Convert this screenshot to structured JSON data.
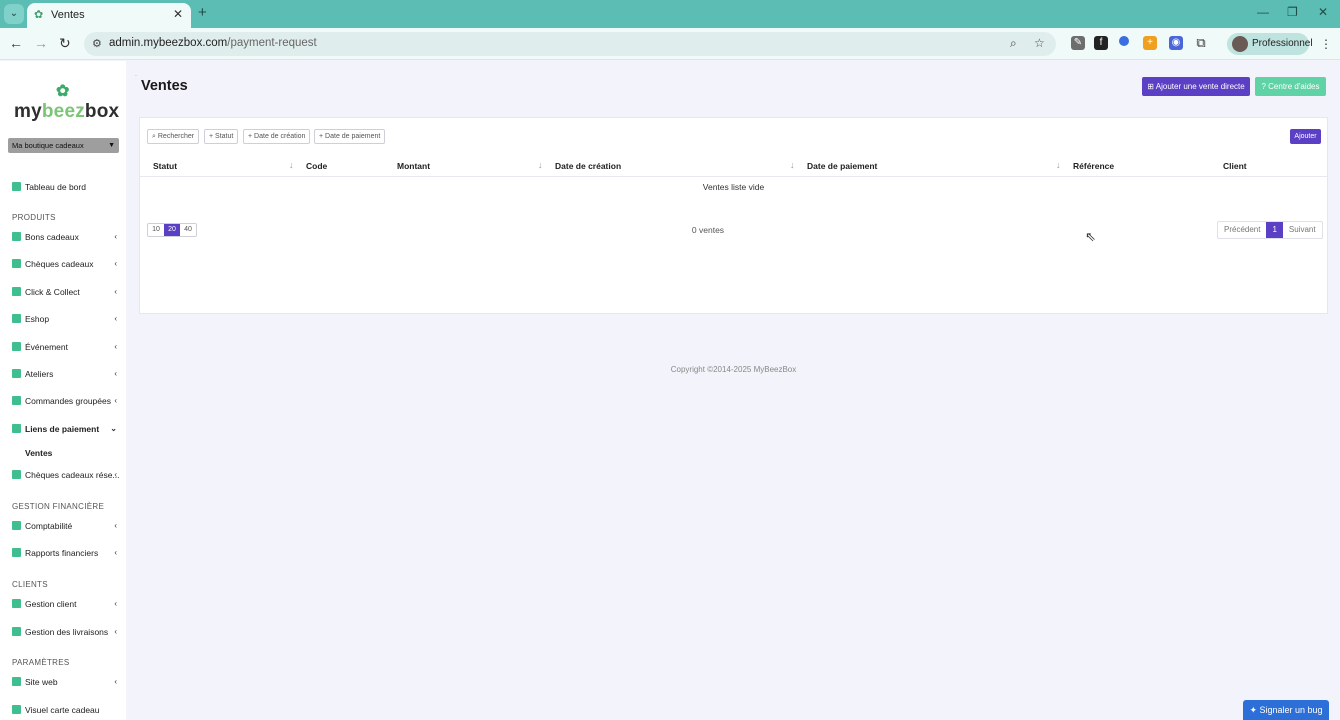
{
  "browser": {
    "tab_title": "Ventes",
    "url_host": "admin.mybeezbox.com",
    "url_path": "/payment-request",
    "profile_label": "Professionnel"
  },
  "sidebar": {
    "logo": {
      "part1": "my",
      "part2": "beez",
      "part3": "box"
    },
    "shop_select": "Ma boutique cadeaux",
    "dashboard": "Tableau de bord",
    "sections": {
      "produits": "PRODUITS",
      "gestion_financiere": "GESTION FINANCIÈRE",
      "clients": "CLIENTS",
      "parametres": "PARAMÈTRES"
    },
    "items": {
      "bons": "Bons cadeaux",
      "cheques": "Chèques cadeaux",
      "click_collect": "Click & Collect",
      "eshop": "Eshop",
      "evenement": "Événement",
      "ateliers": "Ateliers",
      "commandes": "Commandes groupées",
      "liens": "Liens de paiement",
      "ventes": "Ventes",
      "cheques_reseau": "Chèques cadeaux rése...",
      "comptabilite": "Comptabilité",
      "rapports": "Rapports financiers",
      "gestion_client": "Gestion client",
      "gestion_livraisons": "Gestion des livraisons",
      "site_web": "Site web",
      "visuel": "Visuel carte cadeau"
    }
  },
  "header": {
    "title": "Ventes",
    "add_direct": "Ajouter une vente directe",
    "help_center": "Centre d'aides"
  },
  "filters": {
    "search": "Rechercher",
    "statut": "Statut",
    "date_creation": "Date de création",
    "date_paiement": "Date de paiement",
    "add": "Ajouter"
  },
  "table": {
    "columns": [
      "Statut",
      "Code",
      "Montant",
      "Date de création",
      "Date de paiement",
      "Référence",
      "Client"
    ],
    "empty_text": "Ventes liste vide"
  },
  "pagination": {
    "sizes": [
      "10",
      "20",
      "40"
    ],
    "selected_size": "20",
    "count": "0 ventes",
    "prev": "Précédent",
    "current": "1",
    "next": "Suivant"
  },
  "footer": {
    "copyright": "Copyright ©2014-2025 MyBeezBox",
    "bug_button": "Signaler un bug"
  },
  "colors": {
    "accent": "#5b3fc4",
    "help": "#5fd3a6",
    "bug": "#2d6fd8",
    "browser_tabbar": "#5bbdb3"
  }
}
